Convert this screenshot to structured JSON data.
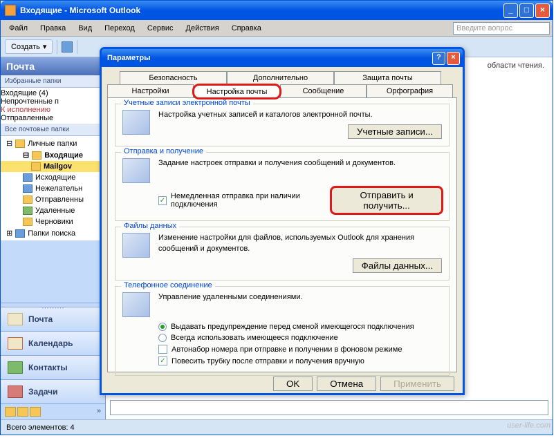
{
  "window": {
    "title": "Входящие - Microsoft Outlook"
  },
  "menu": {
    "file": "Файл",
    "edit": "Правка",
    "view": "Вид",
    "goto": "Переход",
    "service": "Сервис",
    "actions": "Действия",
    "help": "Справка",
    "search_placeholder": "Введите вопрос"
  },
  "toolbar": {
    "create": "Создать"
  },
  "sidebar": {
    "header": "Почта",
    "fav_header": "Избранные папки",
    "fav": [
      {
        "label": "Входящие (4)",
        "bold": true
      },
      {
        "label": "Непрочтенные п"
      },
      {
        "label": "К исполнению"
      },
      {
        "label": "Отправленные"
      }
    ],
    "all_header": "Все почтовые папки",
    "tree": {
      "root": "Личные папки",
      "inbox": "Входящие",
      "mailgov": "Mailgov",
      "outbox": "Исходящие",
      "junk": "Нежелательн",
      "sent": "Отправленны",
      "deleted": "Удаленные",
      "drafts": "Черновики",
      "search": "Папки поиска"
    },
    "nav": {
      "mail": "Почта",
      "calendar": "Календарь",
      "contacts": "Контакты",
      "tasks": "Задачи"
    }
  },
  "main_pane": {
    "hint": "области чтения."
  },
  "dialog": {
    "title": "Параметры",
    "tabs_top": [
      "Безопасность",
      "Дополнительно",
      "Защита почты"
    ],
    "tabs_bottom": [
      "Настройки",
      "Настройка почты",
      "Сообщение",
      "Орфография"
    ],
    "sections": {
      "accounts": {
        "label": "Учетные записи электронной почты",
        "desc": "Настройка учетных записей и каталогов электронной почты.",
        "button": "Учетные записи..."
      },
      "sendrecv": {
        "label": "Отправка и получение",
        "desc": "Задание настроек отправки и получения сообщений и документов.",
        "checkbox": "Немедленная отправка при наличии подключения",
        "button": "Отправить и получить..."
      },
      "datafiles": {
        "label": "Файлы данных",
        "desc": "Изменение настройки для файлов, используемых Outlook для хранения сообщений и документов.",
        "button": "Файлы данных..."
      },
      "dialup": {
        "label": "Телефонное соединение",
        "desc": "Управление удаленными соединениями.",
        "radio1": "Выдавать предупреждение перед сменой имеющегося подключения",
        "radio2": "Всегда использовать имеющееся подключение",
        "check1": "Автонабор номера при отправке и получении в фоновом режиме",
        "check2": "Повесить трубку после отправки и получения вручную"
      }
    },
    "buttons": {
      "ok": "OK",
      "cancel": "Отмена",
      "apply": "Применить"
    }
  },
  "statusbar": {
    "items": "Всего элементов: 4"
  },
  "watermark": "user-life.com"
}
